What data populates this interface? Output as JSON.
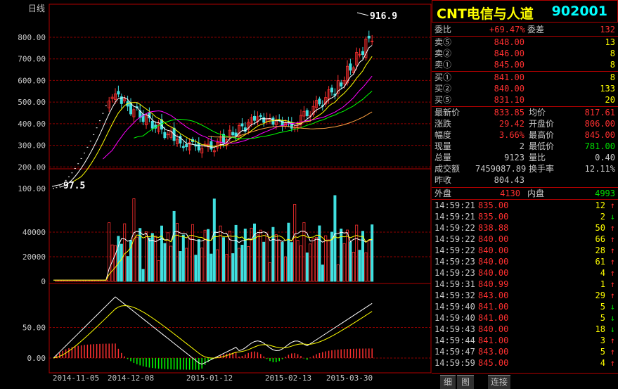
{
  "chart": {
    "period_label": "日线",
    "price_ticks": [
      "800.00",
      "700.00",
      "600.00",
      "500.00",
      "400.00",
      "300.00",
      "200.00",
      "100.00"
    ],
    "volume_ticks": [
      "40000",
      "20000",
      "0"
    ],
    "macd_ticks": [
      "50.00",
      "0.00"
    ],
    "date_labels": [
      "2014-11-05",
      "2014-12-08",
      "2015-01-12",
      "2015-02-13",
      "2015-03-30"
    ],
    "high_label": "916.9",
    "low_label": "97.5",
    "colors": {
      "up": "#ff3030",
      "down": "#40e0e0",
      "grid": "#8b0000",
      "ma5": "#ffffff",
      "ma10": "#ffff00",
      "ma20": "#ff00ff",
      "ma30": "#00ff00",
      "ma60": "#ffa040"
    }
  },
  "panel": {
    "title_name": "CNT电信与人道",
    "title_code": "902001",
    "committee": {
      "l1": "委比",
      "v1": "+69.47%",
      "l2": "委差",
      "v2": "132"
    },
    "asks": [
      {
        "label": "卖⑤",
        "price": "848.00",
        "vol": "13"
      },
      {
        "label": "卖②",
        "price": "846.00",
        "vol": "8"
      },
      {
        "label": "卖①",
        "price": "845.00",
        "vol": "8"
      }
    ],
    "bids": [
      {
        "label": "买①",
        "price": "841.00",
        "vol": "8"
      },
      {
        "label": "买②",
        "price": "840.00",
        "vol": "133"
      },
      {
        "label": "买⑤",
        "price": "831.10",
        "vol": "20"
      }
    ],
    "quote": [
      {
        "l1": "最新价",
        "v1": "833.85",
        "l2": "均价",
        "v2": "817.61",
        "c1": "red",
        "c2": "red"
      },
      {
        "l1": "涨跌",
        "v1": "29.42",
        "l2": "开盘价",
        "v2": "806.00",
        "c1": "red",
        "c2": "red"
      },
      {
        "l1": "幅度",
        "v1": "3.66%",
        "l2": "最高价",
        "v2": "845.00",
        "c1": "red",
        "c2": "red"
      },
      {
        "l1": "现量",
        "v1": "2",
        "l2": "最低价",
        "v2": "781.00",
        "c1": "wht",
        "c2": "grn"
      },
      {
        "l1": "总量",
        "v1": "9123",
        "l2": "量比",
        "v2": "0.40",
        "c1": "wht",
        "c2": "wht"
      },
      {
        "l1": "成交额",
        "v1": "7459087.89",
        "l2": "换手率",
        "v2": "12.11%",
        "c1": "wht",
        "c2": "wht"
      },
      {
        "l1": "昨收",
        "v1": "804.43",
        "l2": "",
        "v2": "",
        "c1": "wht",
        "c2": "wht"
      }
    ],
    "outer_label": "外盘",
    "outer_val": "4130",
    "inner_label": "内盘",
    "inner_val": "4993",
    "ticks": [
      {
        "time": "14:59:21",
        "price": "835.00",
        "vol": "12",
        "dir": "↑"
      },
      {
        "time": "14:59:21",
        "price": "835.00",
        "vol": "2",
        "dir": "↓"
      },
      {
        "time": "14:59:22",
        "price": "838.88",
        "vol": "50",
        "dir": "↑"
      },
      {
        "time": "14:59:22",
        "price": "840.00",
        "vol": "66",
        "dir": "↑"
      },
      {
        "time": "14:59:22",
        "price": "840.00",
        "vol": "28",
        "dir": "↑"
      },
      {
        "time": "14:59:23",
        "price": "840.00",
        "vol": "61",
        "dir": "↑"
      },
      {
        "time": "14:59:23",
        "price": "840.00",
        "vol": "4",
        "dir": "↑"
      },
      {
        "time": "14:59:31",
        "price": "840.99",
        "vol": "1",
        "dir": "↑"
      },
      {
        "time": "14:59:32",
        "price": "843.00",
        "vol": "29",
        "dir": "↑"
      },
      {
        "time": "14:59:40",
        "price": "841.00",
        "vol": "5",
        "dir": "↓"
      },
      {
        "time": "14:59:40",
        "price": "841.00",
        "vol": "5",
        "dir": "↓"
      },
      {
        "time": "14:59:43",
        "price": "840.00",
        "vol": "18",
        "dir": "↓"
      },
      {
        "time": "14:59:44",
        "price": "841.00",
        "vol": "3",
        "dir": "↑"
      },
      {
        "time": "14:59:47",
        "price": "843.00",
        "vol": "5",
        "dir": "↑"
      },
      {
        "time": "14:59:59",
        "price": "845.00",
        "vol": "4",
        "dir": "↑"
      }
    ],
    "tabs": [
      "细",
      "图",
      "连接"
    ]
  }
}
